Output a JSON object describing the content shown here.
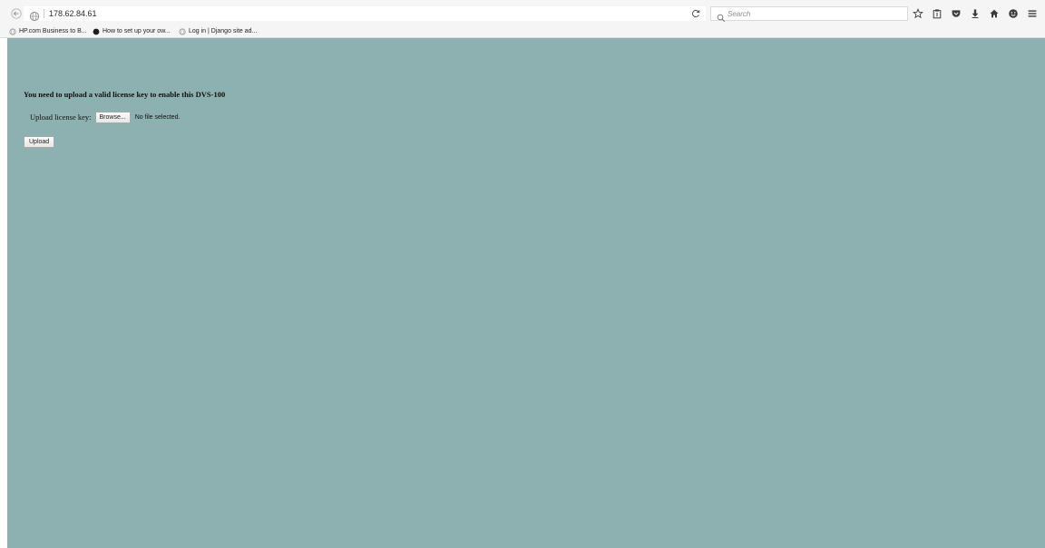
{
  "browser": {
    "url": "178.62.84.61",
    "search_placeholder": "Search",
    "icons": {
      "back": "back-arrow-icon",
      "site": "globe-icon",
      "reload": "reload-icon",
      "search": "magnifier-icon",
      "toolbar": [
        "star-icon",
        "clipboard-icon",
        "pocket-icon",
        "download-icon",
        "home-icon",
        "hello-icon",
        "hamburger-menu-icon"
      ]
    }
  },
  "bookmarks": [
    {
      "label": "HP.com Business to B...",
      "icon": "globe-icon"
    },
    {
      "label": "How to set up your ow...",
      "icon": "black-circle-icon"
    },
    {
      "label": "Log in | Django site ad...",
      "icon": "globe-icon"
    }
  ],
  "page": {
    "background_color": "#8db0b0",
    "message": "You need to upload a valid license key to enable this DVS-100",
    "upload_label": "Upload license key:",
    "browse_label": "Browse...",
    "file_status": "No file selected.",
    "upload_button_label": "Upload"
  }
}
